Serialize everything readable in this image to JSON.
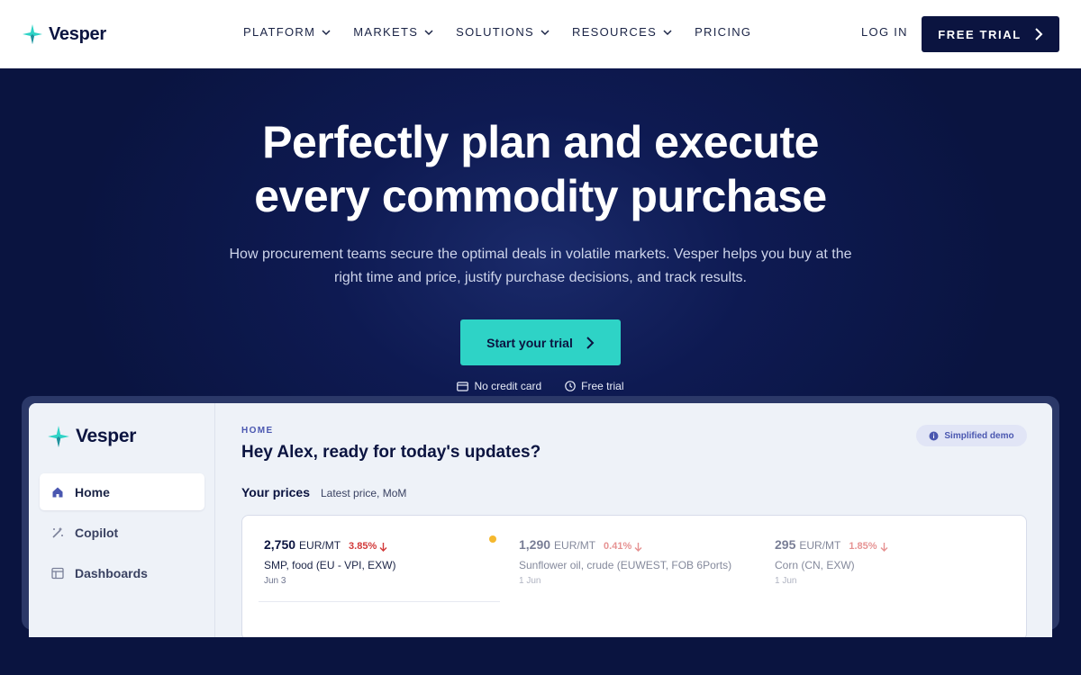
{
  "brand": {
    "name": "Vesper",
    "accent": "#2ed3c6",
    "navy": "#0b1440"
  },
  "nav": {
    "links": [
      {
        "label": "PLATFORM",
        "dropdown": true
      },
      {
        "label": "MARKETS",
        "dropdown": true
      },
      {
        "label": "SOLUTIONS",
        "dropdown": true
      },
      {
        "label": "RESOURCES",
        "dropdown": true
      },
      {
        "label": "PRICING",
        "dropdown": false
      }
    ],
    "login": "LOG IN",
    "trial": "FREE TRIAL"
  },
  "hero": {
    "title_line1": "Perfectly plan and execute",
    "title_line2": "every commodity purchase",
    "subtitle_line1": "How procurement teams secure the optimal deals in volatile markets. Vesper helps you buy at the",
    "subtitle_line2": "right time and price, justify purchase decisions, and track results.",
    "cta": "Start your trial",
    "perks": [
      {
        "icon": "credit-card-icon",
        "label": "No credit card"
      },
      {
        "icon": "clock-icon",
        "label": "Free trial"
      }
    ]
  },
  "app": {
    "sidebar": [
      {
        "icon": "home-icon",
        "label": "Home",
        "active": true
      },
      {
        "icon": "magic-wand-icon",
        "label": "Copilot",
        "active": false
      },
      {
        "icon": "dashboard-icon",
        "label": "Dashboards",
        "active": false
      }
    ],
    "breadcrumb": "HOME",
    "greeting": "Hey Alex, ready for today's updates?",
    "demo_badge": "Simplified demo",
    "prices_title": "Your prices",
    "prices_subtitle": "Latest price, MoM",
    "prices": [
      {
        "value": "2,750",
        "unit": "EUR/MT",
        "change": "3.85%",
        "direction": "down",
        "name": "SMP, food (EU - VPI, EXW)",
        "date": "Jun 3",
        "highlight": true
      },
      {
        "value": "1,290",
        "unit": "EUR/MT",
        "change": "0.41%",
        "direction": "down",
        "name": "Sunflower oil, crude (EUWEST, FOB 6Ports)",
        "date": "1 Jun",
        "highlight": false
      },
      {
        "value": "295",
        "unit": "EUR/MT",
        "change": "1.85%",
        "direction": "down",
        "name": "Corn (CN, EXW)",
        "date": "1 Jun",
        "highlight": false
      }
    ]
  }
}
